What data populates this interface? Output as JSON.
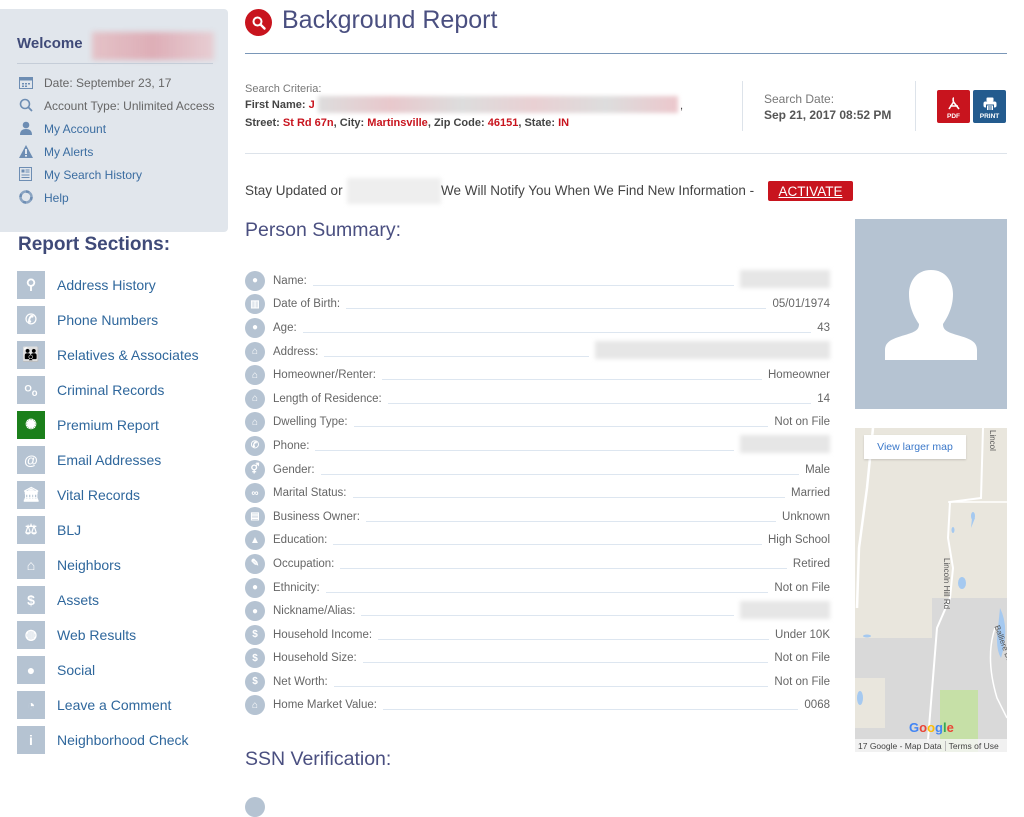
{
  "sidebar": {
    "welcome": "Welcome",
    "account": [
      {
        "icon": "calendar-icon",
        "label": "Date: September 23, 17",
        "link": false
      },
      {
        "icon": "search-icon",
        "label": "Account Type: Unlimited Access",
        "link": false
      },
      {
        "icon": "user-icon",
        "label": "My Account",
        "link": true
      },
      {
        "icon": "alert-icon",
        "label": "My Alerts",
        "link": true
      },
      {
        "icon": "history-icon",
        "label": "My Search History",
        "link": true
      },
      {
        "icon": "help-icon",
        "label": "Help",
        "link": true
      }
    ],
    "sections_title": "Report Sections:",
    "sections": [
      {
        "icon": "map-pin-icon",
        "glyph": "⚲",
        "label": "Address History"
      },
      {
        "icon": "phone-icon",
        "glyph": "✆",
        "label": "Phone Numbers"
      },
      {
        "icon": "people-icon",
        "glyph": "👪",
        "label": "Relatives & Associates"
      },
      {
        "icon": "handcuffs-icon",
        "glyph": "ᴼₒ",
        "label": "Criminal Records"
      },
      {
        "icon": "premium-badge-icon",
        "glyph": "✺",
        "label": "Premium Report",
        "premium": true
      },
      {
        "icon": "at-icon",
        "glyph": "@",
        "label": "Email Addresses"
      },
      {
        "icon": "bank-icon",
        "glyph": "🏛",
        "label": "Vital Records"
      },
      {
        "icon": "gavel-icon",
        "glyph": "⚖",
        "label": "BLJ"
      },
      {
        "icon": "houses-icon",
        "glyph": "⌂",
        "label": "Neighbors"
      },
      {
        "icon": "dollar-icon",
        "glyph": "$",
        "label": "Assets"
      },
      {
        "icon": "globe-icon",
        "glyph": "◍",
        "label": "Web Results"
      },
      {
        "icon": "user-icon",
        "glyph": "●",
        "label": "Social"
      },
      {
        "icon": "comment-icon",
        "glyph": "◔",
        "label": "Leave a Comment"
      },
      {
        "icon": "info-icon",
        "glyph": "i",
        "label": "Neighborhood Check"
      }
    ]
  },
  "header": {
    "title": "Background Report",
    "criteria_label": "Search Criteria:",
    "first_name_label": "First Name:",
    "first_name_initial": "J",
    "street_label": "Street:",
    "street": "St Rd 67n",
    "city_label": "City:",
    "city": "Martinsville",
    "zip_label": "Zip Code:",
    "zip": "46151",
    "state_label": "State:",
    "state": "IN",
    "search_date_label": "Search Date:",
    "search_date": "Sep 21, 2017 08:52 PM",
    "pdf_label": "PDF",
    "print_label": "PRINT"
  },
  "notify": {
    "prefix": "Stay Updated or",
    "suffix": "We Will Notify You When We Find New Information -",
    "activate": "ACTIVATE"
  },
  "summary": {
    "title": "Person Summary:",
    "rows": [
      {
        "icon": "user-icon",
        "glyph": "●",
        "label": "Name:",
        "value": "",
        "redacted": true
      },
      {
        "icon": "cake-icon",
        "glyph": "▥",
        "label": "Date of Birth:",
        "value": "05/01/1974"
      },
      {
        "icon": "user-icon",
        "glyph": "●",
        "label": "Age:",
        "value": "43"
      },
      {
        "icon": "home-icon",
        "glyph": "⌂",
        "label": "Address:",
        "value": "",
        "redacted": true,
        "wide": true
      },
      {
        "icon": "home-icon",
        "glyph": "⌂",
        "label": "Homeowner/Renter:",
        "value": "Homeowner"
      },
      {
        "icon": "home-icon",
        "glyph": "⌂",
        "label": "Length of Residence:",
        "value": "14"
      },
      {
        "icon": "home-icon",
        "glyph": "⌂",
        "label": "Dwelling Type:",
        "value": "Not on File"
      },
      {
        "icon": "phone-icon",
        "glyph": "✆",
        "label": "Phone:",
        "value": "",
        "redacted": true
      },
      {
        "icon": "gender-icon",
        "glyph": "⚥",
        "label": "Gender:",
        "value": "Male"
      },
      {
        "icon": "rings-icon",
        "glyph": "∞",
        "label": "Marital Status:",
        "value": "Married"
      },
      {
        "icon": "briefcase-icon",
        "glyph": "▤",
        "label": "Business Owner:",
        "value": "Unknown"
      },
      {
        "icon": "graduation-cap-icon",
        "glyph": "▲",
        "label": "Education:",
        "value": "High School"
      },
      {
        "icon": "pencil-icon",
        "glyph": "✎",
        "label": "Occupation:",
        "value": "Retired"
      },
      {
        "icon": "user-icon",
        "glyph": "●",
        "label": "Ethnicity:",
        "value": "Not on File"
      },
      {
        "icon": "user-icon",
        "glyph": "●",
        "label": "Nickname/Alias:",
        "value": "",
        "redacted": true
      },
      {
        "icon": "dollar-icon",
        "glyph": "$",
        "label": "Household Income:",
        "value": "Under 10K"
      },
      {
        "icon": "dollar-icon",
        "glyph": "$",
        "label": "Household Size:",
        "value": "Not on File"
      },
      {
        "icon": "money-bag-icon",
        "glyph": "$",
        "label": "Net Worth:",
        "value": "Not on File"
      },
      {
        "icon": "home-icon",
        "glyph": "⌂",
        "label": "Home Market Value:",
        "value": "0068"
      }
    ]
  },
  "map": {
    "larger_map": "View larger map",
    "road1": "Lincoln Hill Rd",
    "road2": "Balliere Dr",
    "road3": "Lincol",
    "attribution": "17 Google - Map Data",
    "terms": "Terms of Use"
  },
  "ssn": {
    "title": "SSN Verification:"
  },
  "colors": {
    "brand_red": "#c8141e",
    "heading": "#4a4f80",
    "link": "#2f679c",
    "icon_bg": "#b5c3d2",
    "premium": "#1b7f1b",
    "print_blue": "#235b8e"
  }
}
